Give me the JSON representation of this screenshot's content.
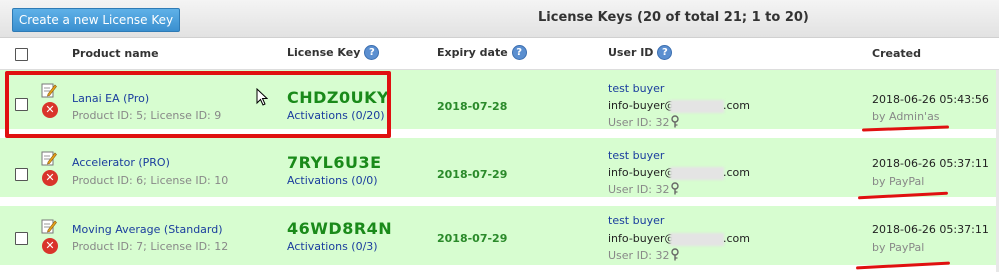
{
  "toolbar": {
    "create_label": "Create a new License Key",
    "title": "License Keys (20 of total 21; 1 to 20)"
  },
  "columns": {
    "product": "Product name",
    "license_key": "License Key",
    "expiry": "Expiry date",
    "user_id": "User ID",
    "created": "Created",
    "help_glyph": "?"
  },
  "icons": {
    "delete_glyph": "✕",
    "edit_icon": "edit-icon",
    "delete_icon": "delete-icon",
    "help_icon": "help-icon",
    "key_icon": "key-icon"
  },
  "colors": {
    "row_bg": "#d7fdd0",
    "highlight": "#e01010",
    "key_green": "#1a8a1a",
    "link_blue": "#1a3d9e",
    "button_blue": "#3a8fcf"
  },
  "rows": [
    {
      "product_name": "Lanai EA (Pro)",
      "product_meta": "Product ID: 5; License ID: 9",
      "license_key": "CHDZ0UKY",
      "activations": "Activations (0/20)",
      "expiry": "2018-07-28",
      "user_name": "test buyer",
      "email_prefix": "info-buyer@",
      "email_suffix": ".com",
      "user_id": "User ID: 32",
      "created": "2018-06-26 05:43:56",
      "created_by": "by Admin'as"
    },
    {
      "product_name": "Accelerator (PRO)",
      "product_meta": "Product ID: 6; License ID: 10",
      "license_key": "7RYL6U3E",
      "activations": "Activations (0/0)",
      "expiry": "2018-07-29",
      "user_name": "test buyer",
      "email_prefix": "info-buyer@",
      "email_suffix": ".com",
      "user_id": "User ID: 32",
      "created": "2018-06-26 05:37:11",
      "created_by": "by PayPal"
    },
    {
      "product_name": "Moving Average (Standard)",
      "product_meta": "Product ID: 7; License ID: 12",
      "license_key": "46WD8R4N",
      "activations": "Activations (0/3)",
      "expiry": "2018-07-29",
      "user_name": "test buyer",
      "email_prefix": "info-buyer@",
      "email_suffix": ".com",
      "user_id": "User ID: 32",
      "created": "2018-06-26 05:37:11",
      "created_by": "by PayPal"
    }
  ]
}
